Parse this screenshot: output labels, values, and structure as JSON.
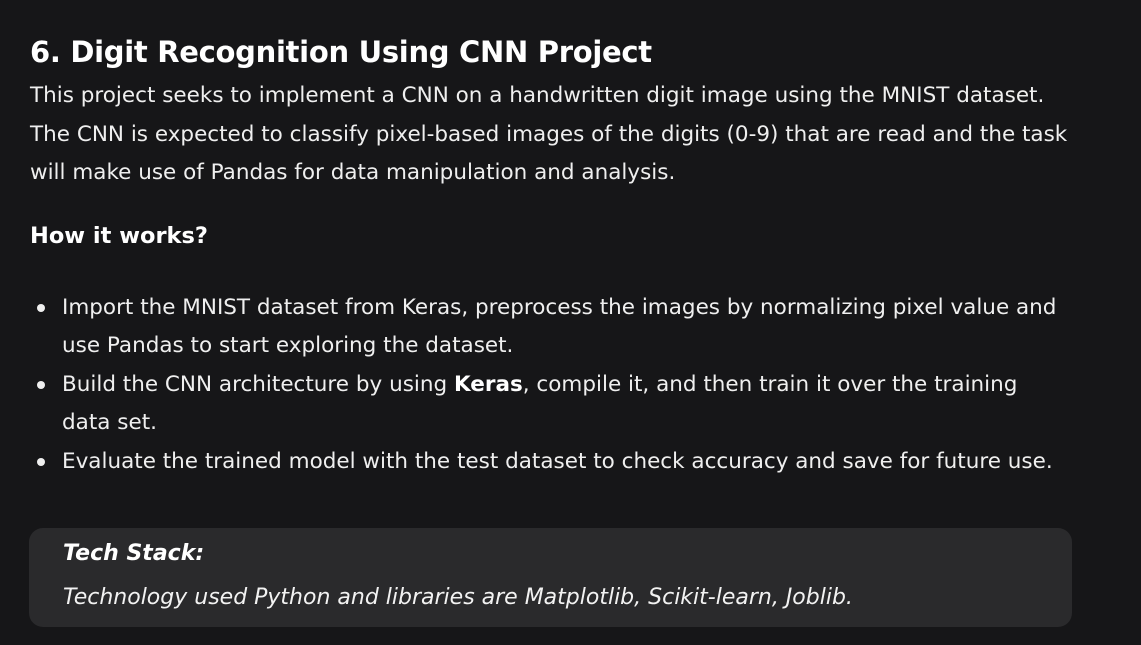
{
  "article": {
    "title": "6. Digit Recognition Using CNN Project",
    "intro": "This project seeks to implement a CNN on a handwritten digit image using the MNIST dataset. The CNN is expected to classify pixel-based images of the digits (0-9) that are read and the task will make use of Pandas for data manipulation and analysis.",
    "how_heading": "How it works?",
    "steps": [
      {
        "text": "Import the MNIST dataset from Keras, preprocess the images by normalizing pixel value and use Pandas to start exploring the dataset."
      },
      {
        "before": "Build the CNN architecture by using ",
        "bold": "Keras",
        "after": ", compile it, and then train it over the training data set."
      },
      {
        "text": "Evaluate the trained model with the test dataset to check accuracy and save for future use."
      }
    ],
    "tech_stack": {
      "label": "Tech Stack:",
      "text": "Technology used Python and libraries are Matplotlib, Scikit-learn, Joblib."
    }
  },
  "colors": {
    "background": "#161618",
    "card": "#2a2a2c",
    "text": "#efefef"
  }
}
